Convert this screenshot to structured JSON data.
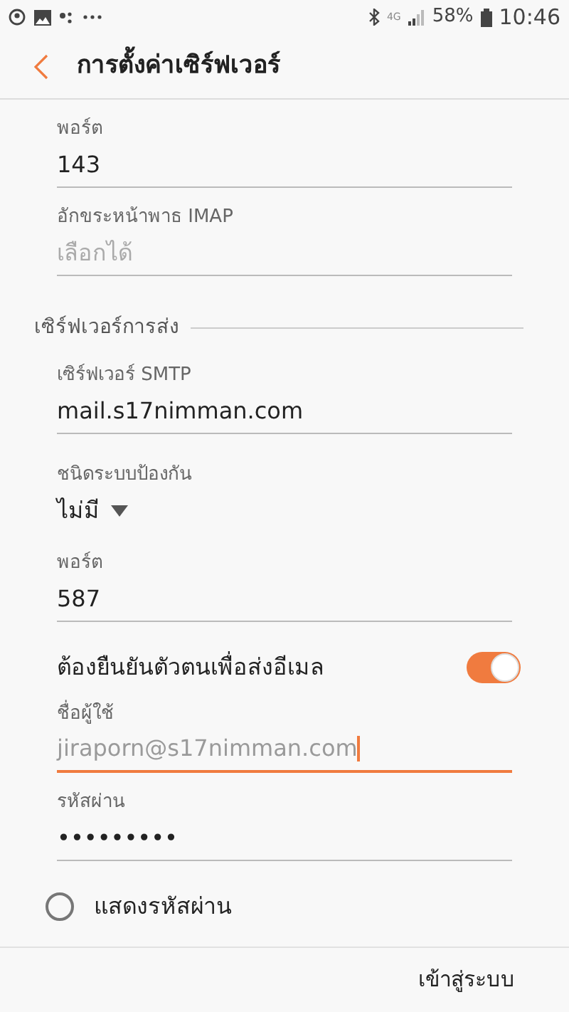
{
  "status_bar": {
    "battery": "58%",
    "time": "10:46",
    "network": "4G"
  },
  "header": {
    "title": "การตั้งค่าเซิร์ฟเวอร์"
  },
  "items": [
    {
      "kind": "field",
      "label": "พอร์ต",
      "value": "143",
      "focused": false
    },
    {
      "kind": "field",
      "label": "อักขระหน้าพาธ IMAP",
      "placeholder": "เลือกได้",
      "focused": false
    },
    {
      "kind": "section",
      "label": "เซิร์ฟเวอร์การส่ง"
    },
    {
      "kind": "field",
      "label": "เซิร์ฟเวอร์ SMTP",
      "value": "mail.s17nimman.com",
      "focused": false
    },
    {
      "kind": "dropdown",
      "label": "ชนิดระบบป้องกัน",
      "value": "ไม่มี"
    },
    {
      "kind": "field",
      "label": "พอร์ต",
      "value": "587",
      "focused": false
    },
    {
      "kind": "toggle",
      "label": "ต้องยืนยันตัวตนเพื่อส่งอีเมล",
      "on": true
    },
    {
      "kind": "field",
      "label": "ชื่อผู้ใช้",
      "value": "jiraporn@s17nimman.com",
      "focused": true
    },
    {
      "kind": "field",
      "label": "รหัสผ่าน",
      "value": "•••••••••",
      "focused": false
    },
    {
      "kind": "radio",
      "label": "แสดงรหัสผ่าน",
      "checked": false
    }
  ],
  "footer": {
    "button": "เข้าสู่ระบบ"
  }
}
